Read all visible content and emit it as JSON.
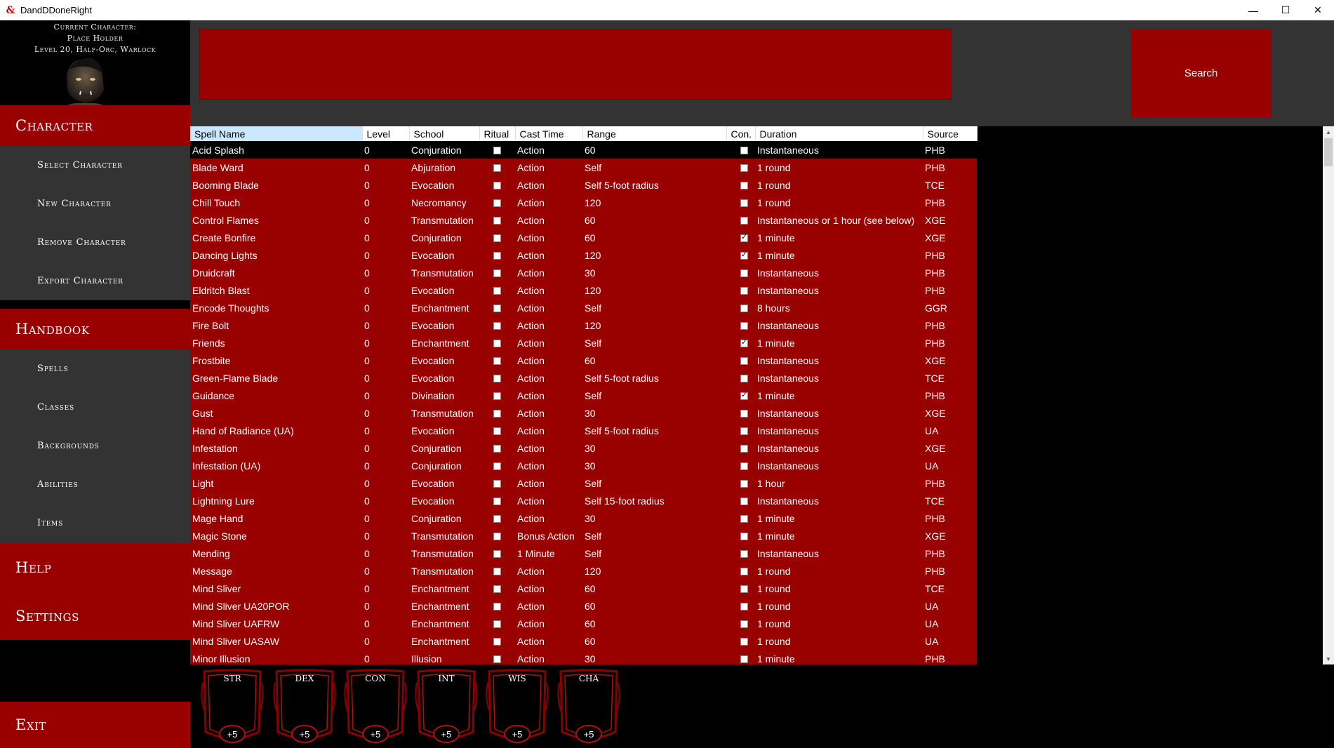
{
  "window": {
    "title": "DandDDoneRight",
    "logo_glyph": "&",
    "minimize": "—",
    "maximize": "☐",
    "close": "✕"
  },
  "character": {
    "line1": "Current Character:",
    "line2": "Place Holder",
    "line3": "Level 20, Half-Orc, Warlock"
  },
  "nav": {
    "character": "Character",
    "character_items": [
      "Select Character",
      "New Character",
      "Remove Character",
      "Export Character"
    ],
    "handbook": "Handbook",
    "handbook_items": [
      "Spells",
      "Classes",
      "Backgrounds",
      "Abilities",
      "Items"
    ],
    "help": "Help",
    "settings": "Settings",
    "exit": "Exit"
  },
  "search": {
    "button_label": "Search",
    "value": ""
  },
  "table": {
    "columns": [
      "Spell Name",
      "Level",
      "School",
      "Ritual",
      "Cast Time",
      "Range",
      "Con.",
      "Duration",
      "Source"
    ],
    "rows": [
      {
        "name": "Acid Splash",
        "level": "0",
        "school": "Conjuration",
        "ritual": false,
        "cast": "Action",
        "range": "60",
        "con": false,
        "duration": "Instantaneous",
        "source": "PHB"
      },
      {
        "name": "Blade Ward",
        "level": "0",
        "school": "Abjuration",
        "ritual": false,
        "cast": "Action",
        "range": "Self",
        "con": false,
        "duration": "1 round",
        "source": "PHB"
      },
      {
        "name": "Booming Blade",
        "level": "0",
        "school": "Evocation",
        "ritual": false,
        "cast": "Action",
        "range": "Self 5-foot radius",
        "con": false,
        "duration": "1 round",
        "source": "TCE"
      },
      {
        "name": "Chill Touch",
        "level": "0",
        "school": "Necromancy",
        "ritual": false,
        "cast": "Action",
        "range": "120",
        "con": false,
        "duration": "1 round",
        "source": "PHB"
      },
      {
        "name": "Control Flames",
        "level": "0",
        "school": "Transmutation",
        "ritual": false,
        "cast": "Action",
        "range": "60",
        "con": false,
        "duration": "Instantaneous or 1 hour (see below)",
        "source": "XGE"
      },
      {
        "name": "Create Bonfire",
        "level": "0",
        "school": "Conjuration",
        "ritual": false,
        "cast": "Action",
        "range": "60",
        "con": true,
        "duration": "1 minute",
        "source": "XGE"
      },
      {
        "name": "Dancing Lights",
        "level": "0",
        "school": "Evocation",
        "ritual": false,
        "cast": "Action",
        "range": "120",
        "con": true,
        "duration": "1 minute",
        "source": "PHB"
      },
      {
        "name": "Druidcraft",
        "level": "0",
        "school": "Transmutation",
        "ritual": false,
        "cast": "Action",
        "range": "30",
        "con": false,
        "duration": "Instantaneous",
        "source": "PHB"
      },
      {
        "name": "Eldritch Blast",
        "level": "0",
        "school": "Evocation",
        "ritual": false,
        "cast": "Action",
        "range": "120",
        "con": false,
        "duration": "Instantaneous",
        "source": "PHB"
      },
      {
        "name": "Encode Thoughts",
        "level": "0",
        "school": "Enchantment",
        "ritual": false,
        "cast": "Action",
        "range": "Self",
        "con": false,
        "duration": "8 hours",
        "source": "GGR"
      },
      {
        "name": "Fire Bolt",
        "level": "0",
        "school": "Evocation",
        "ritual": false,
        "cast": "Action",
        "range": "120",
        "con": false,
        "duration": "Instantaneous",
        "source": "PHB"
      },
      {
        "name": "Friends",
        "level": "0",
        "school": "Enchantment",
        "ritual": false,
        "cast": "Action",
        "range": "Self",
        "con": true,
        "duration": "1 minute",
        "source": "PHB"
      },
      {
        "name": "Frostbite",
        "level": "0",
        "school": "Evocation",
        "ritual": false,
        "cast": "Action",
        "range": "60",
        "con": false,
        "duration": "Instantaneous",
        "source": "XGE"
      },
      {
        "name": "Green-Flame Blade",
        "level": "0",
        "school": "Evocation",
        "ritual": false,
        "cast": "Action",
        "range": "Self 5-foot radius",
        "con": false,
        "duration": "Instantaneous",
        "source": "TCE"
      },
      {
        "name": "Guidance",
        "level": "0",
        "school": "Divination",
        "ritual": false,
        "cast": "Action",
        "range": "Self",
        "con": true,
        "duration": "1 minute",
        "source": "PHB"
      },
      {
        "name": "Gust",
        "level": "0",
        "school": "Transmutation",
        "ritual": false,
        "cast": "Action",
        "range": "30",
        "con": false,
        "duration": "Instantaneous",
        "source": "XGE"
      },
      {
        "name": "Hand of Radiance (UA)",
        "level": "0",
        "school": "Evocation",
        "ritual": false,
        "cast": "Action",
        "range": "Self 5-foot radius",
        "con": false,
        "duration": "Instantaneous",
        "source": "UA"
      },
      {
        "name": "Infestation",
        "level": "0",
        "school": "Conjuration",
        "ritual": false,
        "cast": "Action",
        "range": "30",
        "con": false,
        "duration": "Instantaneous",
        "source": "XGE"
      },
      {
        "name": "Infestation (UA)",
        "level": "0",
        "school": "Conjuration",
        "ritual": false,
        "cast": "Action",
        "range": "30",
        "con": false,
        "duration": "Instantaneous",
        "source": "UA"
      },
      {
        "name": "Light",
        "level": "0",
        "school": "Evocation",
        "ritual": false,
        "cast": "Action",
        "range": "Self",
        "con": false,
        "duration": "1 hour",
        "source": "PHB"
      },
      {
        "name": "Lightning Lure",
        "level": "0",
        "school": "Evocation",
        "ritual": false,
        "cast": "Action",
        "range": "Self 15-foot radius",
        "con": false,
        "duration": "Instantaneous",
        "source": "TCE"
      },
      {
        "name": "Mage Hand",
        "level": "0",
        "school": "Conjuration",
        "ritual": false,
        "cast": "Action",
        "range": "30",
        "con": false,
        "duration": "1 minute",
        "source": "PHB"
      },
      {
        "name": "Magic Stone",
        "level": "0",
        "school": "Transmutation",
        "ritual": false,
        "cast": "Bonus Action",
        "range": "Self",
        "con": false,
        "duration": "1 minute",
        "source": "XGE"
      },
      {
        "name": "Mending",
        "level": "0",
        "school": "Transmutation",
        "ritual": false,
        "cast": "1 Minute",
        "range": "Self",
        "con": false,
        "duration": "Instantaneous",
        "source": "PHB"
      },
      {
        "name": "Message",
        "level": "0",
        "school": "Transmutation",
        "ritual": false,
        "cast": "Action",
        "range": "120",
        "con": false,
        "duration": "1 round",
        "source": "PHB"
      },
      {
        "name": "Mind Sliver",
        "level": "0",
        "school": "Enchantment",
        "ritual": false,
        "cast": "Action",
        "range": "60",
        "con": false,
        "duration": "1 round",
        "source": "TCE"
      },
      {
        "name": "Mind Sliver UA20POR",
        "level": "0",
        "school": "Enchantment",
        "ritual": false,
        "cast": "Action",
        "range": "60",
        "con": false,
        "duration": "1 round",
        "source": "UA"
      },
      {
        "name": "Mind Sliver UAFRW",
        "level": "0",
        "school": "Enchantment",
        "ritual": false,
        "cast": "Action",
        "range": "60",
        "con": false,
        "duration": "1 round",
        "source": "UA"
      },
      {
        "name": "Mind Sliver UASAW",
        "level": "0",
        "school": "Enchantment",
        "ritual": false,
        "cast": "Action",
        "range": "60",
        "con": false,
        "duration": "1 round",
        "source": "UA"
      },
      {
        "name": "Minor Illusion",
        "level": "0",
        "school": "Illusion",
        "ritual": false,
        "cast": "Action",
        "range": "30",
        "con": false,
        "duration": "1 minute",
        "source": "PHB"
      }
    ]
  },
  "abilities": [
    {
      "label": "STR",
      "mod": "+5"
    },
    {
      "label": "DEX",
      "mod": "+5"
    },
    {
      "label": "CON",
      "mod": "+5"
    },
    {
      "label": "INT",
      "mod": "+5"
    },
    {
      "label": "WIS",
      "mod": "+5"
    },
    {
      "label": "CHA",
      "mod": "+5"
    }
  ],
  "colors": {
    "accent": "#990000",
    "panel": "#333333",
    "background": "#000000"
  }
}
